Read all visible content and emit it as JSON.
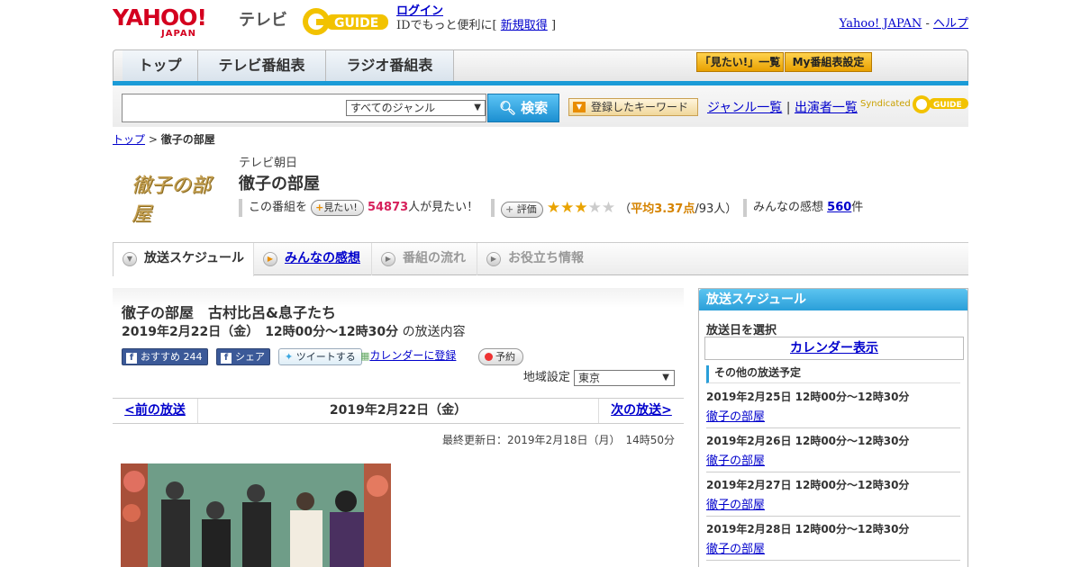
{
  "header": {
    "yahoo_main": "YAHOO!",
    "yahoo_sub": "JAPAN",
    "tv_label": "テレビ",
    "gguide": "GUIDE",
    "login": "ログイン",
    "id_text": "IDでもっと便利に[",
    "register": "新規取得",
    "id_close": "]",
    "yahoo_japan_link": "Yahoo! JAPAN",
    "sep": "-",
    "help": "ヘルプ"
  },
  "nav": {
    "tabs": [
      "トップ",
      "テレビ番組表",
      "ラジオ番組表"
    ],
    "mitai_list": "「見たい!」一覧",
    "my_schedule": "My番組表設定"
  },
  "search": {
    "genre": "すべてのジャンル",
    "search_button": "検索",
    "keyword_button": "登録したキーワード",
    "genre_list": "ジャンル一覧",
    "link_sep": "|",
    "performer_list": "出演者一覧",
    "syndicated": "Syndicated",
    "colors": {
      "accent": "#1a9bd7"
    }
  },
  "breadcrumb": {
    "top": "トップ",
    "sep": ">",
    "current": "徹子の部屋"
  },
  "program": {
    "logo_text": "徹子の部屋",
    "station": "テレビ朝日",
    "title": "徹子の部屋",
    "want_prefix": "この番組を",
    "want_button": "見たい!",
    "want_count": "54873",
    "want_suffix": "人が見たい！",
    "rating_button": "評価",
    "rating_stars": 3,
    "rating_open": "（",
    "rating_avg": "平均3.37点",
    "rating_votes": "/93人）",
    "impressions_label": "みんなの感想",
    "impressions_count": "560",
    "impressions_unit": "件"
  },
  "content_tabs": [
    "放送スケジュール",
    "みんなの感想",
    "番組の流れ",
    "お役立ち情報"
  ],
  "episode": {
    "title": "徹子の部屋　古村比呂&息子たち",
    "datetime": "2019年2月22日（金）　12時00分～12時30分",
    "datetime_suffix": "の放送内容",
    "fb_recommend": "おすすめ",
    "fb_count": "244",
    "fb_share": "シェア",
    "tweet": "ツイートする",
    "calendar": "カレンダーに登録",
    "reserve": "予約",
    "region_label": "地域設定",
    "region_value": "東京",
    "prev": "<前の放送",
    "current_date": "2019年2月22日（金）",
    "next": "次の放送>",
    "updated": "最終更新日：2019年2月18日（月）　14時50分"
  },
  "sidebar": {
    "title": "放送スケジュール",
    "select_date": "放送日を選択",
    "calendar": "カレンダー表示",
    "other": "その他の放送予定",
    "schedules": [
      {
        "datetime": "2019年2月25日  12時00分～12時30分",
        "title": "徹子の部屋"
      },
      {
        "datetime": "2019年2月26日  12時00分～12時30分",
        "title": "徹子の部屋"
      },
      {
        "datetime": "2019年2月27日  12時00分～12時30分",
        "title": "徹子の部屋"
      },
      {
        "datetime": "2019年2月28日  12時00分～12時30分",
        "title": "徹子の部屋"
      }
    ]
  }
}
